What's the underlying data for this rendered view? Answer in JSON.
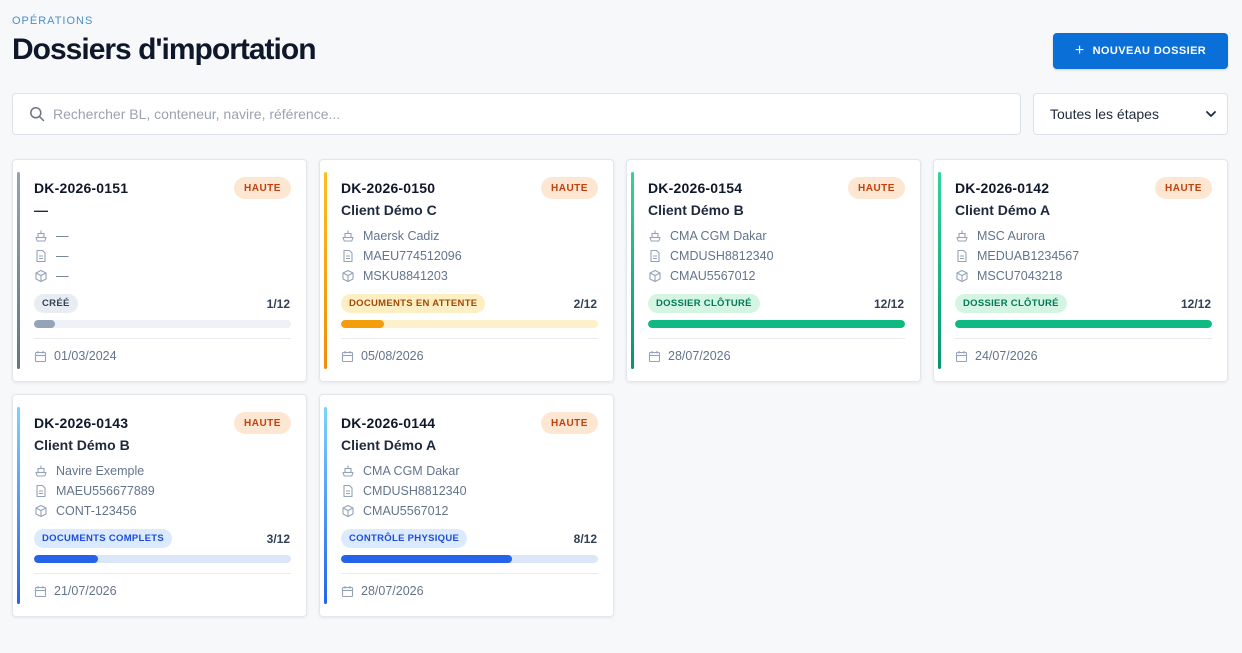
{
  "header": {
    "eyebrow": "OPÉRATIONS",
    "title": "Dossiers d'importation",
    "new_button_label": "NOUVEAU DOSSIER",
    "new_button_icon": "plus-icon"
  },
  "filters": {
    "search_placeholder": "Rechercher BL, conteneur, navire, référence...",
    "search_value": "",
    "stage_selected": "Toutes les étapes"
  },
  "colors": {
    "primary": "#0a6fd6",
    "priority_bg": "#fde7d2",
    "priority_text": "#c2410c"
  },
  "dossiers": [
    {
      "ref": "DK-2026-0151",
      "client": "—",
      "priority": "HAUTE",
      "vessel": "—",
      "bl": "—",
      "container": "—",
      "stage": "CRÉÉ",
      "step": "1/12",
      "progress": 0.083,
      "date": "01/03/2024",
      "stage_bg": "#e8edf3",
      "stage_color": "#334155",
      "accent": "#94a3b8",
      "accent_end": "#64748b",
      "fill": "#94a3b8",
      "track": "#eef1f5"
    },
    {
      "ref": "DK-2026-0150",
      "client": "Client Démo C",
      "priority": "HAUTE",
      "vessel": "Maersk Cadiz",
      "bl": "MAEU774512096",
      "container": "MSKU8841203",
      "stage": "DOCUMENTS EN ATTENTE",
      "step": "2/12",
      "progress": 0.167,
      "date": "05/08/2026",
      "stage_bg": "#fdefc4",
      "stage_color": "#a14a06",
      "accent": "#fbbf24",
      "accent_end": "#f08c0a",
      "fill": "#f59e0b",
      "track": "#fdf1cc"
    },
    {
      "ref": "DK-2026-0154",
      "client": "Client Démo B",
      "priority": "HAUTE",
      "vessel": "CMA CGM Dakar",
      "bl": "CMDUSH8812340",
      "container": "CMAU5567012",
      "stage": "DOSSIER CLÔTURÉ",
      "step": "12/12",
      "progress": 1.0,
      "date": "28/07/2026",
      "stage_bg": "#d5f5e3",
      "stage_color": "#047857",
      "accent": "#34d399",
      "accent_end": "#059669",
      "fill": "#10b981",
      "track": "#d5f5e3"
    },
    {
      "ref": "DK-2026-0142",
      "client": "Client Démo A",
      "priority": "HAUTE",
      "vessel": "MSC Aurora",
      "bl": "MEDUAB1234567",
      "container": "MSCU7043218",
      "stage": "DOSSIER CLÔTURÉ",
      "step": "12/12",
      "progress": 1.0,
      "date": "24/07/2026",
      "stage_bg": "#d5f5e3",
      "stage_color": "#047857",
      "accent": "#34d399",
      "accent_end": "#059669",
      "fill": "#10b981",
      "track": "#d5f5e3"
    },
    {
      "ref": "DK-2026-0143",
      "client": "Client Démo B",
      "priority": "HAUTE",
      "vessel": "Navire Exemple",
      "bl": "MAEU556677889",
      "container": "CONT-123456",
      "stage": "DOCUMENTS COMPLETS",
      "step": "3/12",
      "progress": 0.25,
      "date": "21/07/2026",
      "stage_bg": "#dbeafe",
      "stage_color": "#1d4ed8",
      "accent": "#7dd3fc",
      "accent_end": "#2563eb",
      "fill": "#2563eb",
      "track": "#dbe7f8"
    },
    {
      "ref": "DK-2026-0144",
      "client": "Client Démo A",
      "priority": "HAUTE",
      "vessel": "CMA CGM Dakar",
      "bl": "CMDUSH8812340",
      "container": "CMAU5567012",
      "stage": "CONTRÔLE PHYSIQUE",
      "step": "8/12",
      "progress": 0.667,
      "date": "28/07/2026",
      "stage_bg": "#dbeafe",
      "stage_color": "#1d4ed8",
      "accent": "#7dd3fc",
      "accent_end": "#2563eb",
      "fill": "#2563eb",
      "track": "#dbe7f8"
    }
  ]
}
